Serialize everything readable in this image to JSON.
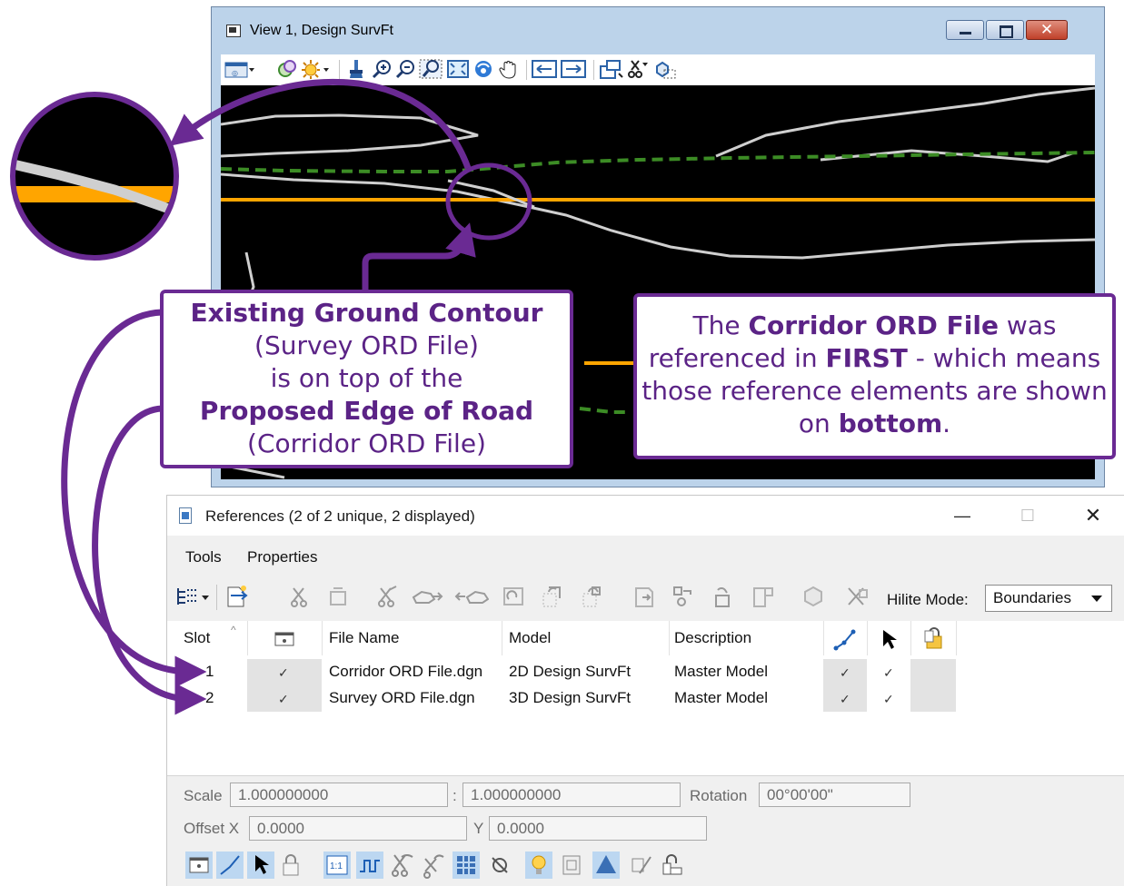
{
  "view_window": {
    "title": "View 1, Design SurvFt",
    "buttons": {
      "minimize": "minimize",
      "maximize": "maximize",
      "close": "✕"
    }
  },
  "callouts": {
    "left": {
      "line1": "Existing Ground Contour",
      "line2": "(Survey ORD File)",
      "line3": "is on top of the",
      "line4": "Proposed Edge of Road",
      "line5": "(Corridor ORD File)"
    },
    "right": {
      "text1": "The ",
      "bold1": "Corridor ORD File",
      "text2": " was referenced in ",
      "bold2": "FIRST",
      "text3": " - which means those reference elements are shown on ",
      "bold3": "bottom",
      "text4": "."
    }
  },
  "references_window": {
    "title": "References (2 of 2 unique, 2 displayed)",
    "menu": [
      "Tools",
      "Properties"
    ],
    "hilite_label": "Hilite Mode:",
    "hilite_value": "Boundaries",
    "columns": {
      "slot": "Slot",
      "file_name": "File Name",
      "model": "Model",
      "description": "Description"
    },
    "rows": [
      {
        "slot": "1",
        "display": "✓",
        "file_name": "Corridor ORD File.dgn",
        "model": "2D Design SurvFt",
        "description": "Master Model",
        "snap": "✓",
        "locate": "✓"
      },
      {
        "slot": "2",
        "display": "✓",
        "file_name": "Survey ORD File.dgn",
        "model": "3D Design SurvFt",
        "description": "Master Model",
        "snap": "✓",
        "locate": "✓"
      }
    ],
    "scale_label": "Scale",
    "scale_value1": "1.000000000",
    "scale_separator": ":",
    "scale_value2": "1.000000000",
    "rotation_label": "Rotation",
    "rotation_value": "00°00'00\"",
    "offset_x_label": "Offset X",
    "offset_x_value": "0.0000",
    "offset_y_label": "Y",
    "offset_y_value": "0.0000"
  },
  "colors": {
    "callout_purple": "#6a2a93",
    "road_orange": "#ffa500",
    "contour_gray": "#cfcfcf",
    "dashed_green": "#3c8c25",
    "canvas_black": "#000000"
  }
}
